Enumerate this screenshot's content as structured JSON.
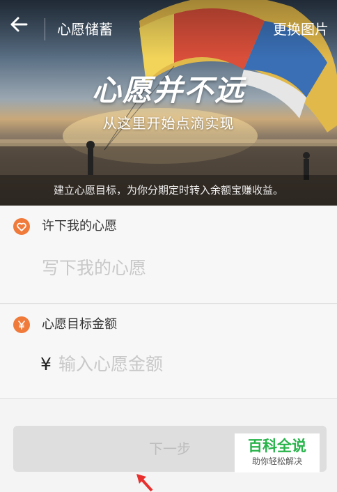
{
  "header": {
    "title": "心愿储蓄",
    "change_image_label": "更换图片"
  },
  "hero": {
    "slogan": "心愿并不远",
    "subtitle": "从这里开始点滴实现",
    "note": "建立心愿目标，为你分期定时转入余额宝赚收益。"
  },
  "wish_section": {
    "label": "许下我的心愿",
    "placeholder": "写下我的心愿"
  },
  "amount_section": {
    "label": "心愿目标金额",
    "currency_symbol": "¥",
    "placeholder": "输入心愿金额"
  },
  "next_button": {
    "label": "下一步"
  },
  "watermark": {
    "title": "百科全说",
    "subtitle": "助你轻松解决"
  },
  "icons": {
    "back": "back-arrow-icon",
    "wish": "heart-icon",
    "amount": "yuan-icon",
    "annotation": "red-arrow-icon"
  },
  "colors": {
    "accent": "#f07a3a",
    "button_bg": "#dedede",
    "watermark_green": "#27b34a",
    "annotation_red": "#e8312f"
  }
}
